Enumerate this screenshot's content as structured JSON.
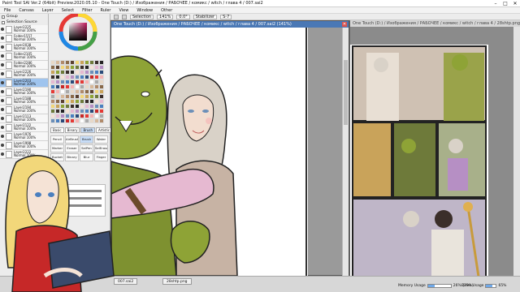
{
  "titlebar": {
    "title": "Paint Tool SAI Ver.2 (64bit) Preview.2020.05.10 - One Touch (D:) / Изображения / РАБОЧЕЕ / комикс / witch / глава 4 / 007.sai2"
  },
  "menu": [
    "File",
    "Canvas",
    "Layer",
    "Select",
    "Filter",
    "Ruler",
    "View",
    "Window",
    "Other"
  ],
  "toolbar": {
    "selection_label": "Selection",
    "zoom": "141%",
    "angle": "0.0°",
    "stabilizer_label": "Stabilizer",
    "stabilizer_value": "S-7"
  },
  "layer_panel": {
    "group_label": "Group",
    "selection_source_label": "Selection Source",
    "layers": [
      {
        "name": "Layer2225",
        "mode": "Normal",
        "opacity": "100%"
      },
      {
        "name": "Folder1557",
        "mode": "Normal",
        "opacity": "100%"
      },
      {
        "name": "Layer2038",
        "mode": "Normal",
        "opacity": "100%"
      },
      {
        "name": "Folder2105",
        "mode": "Normal",
        "opacity": "100%"
      },
      {
        "name": "Folder2286",
        "mode": "Normal",
        "opacity": "100%"
      },
      {
        "name": "Layer2226",
        "mode": "Normal",
        "opacity": "100%"
      },
      {
        "name": "Layer2203",
        "mode": "Normal",
        "opacity": "100%"
      },
      {
        "name": "Layer2190",
        "mode": "Normal",
        "opacity": "100%"
      },
      {
        "name": "Layer2188",
        "mode": "Normal",
        "opacity": "100%"
      },
      {
        "name": "Layer2194",
        "mode": "Normal",
        "opacity": "100%"
      },
      {
        "name": "Layer2113",
        "mode": "Normal",
        "opacity": "100%"
      },
      {
        "name": "Layer2122",
        "mode": "Normal",
        "opacity": "100%"
      },
      {
        "name": "Layer1976",
        "mode": "Normal",
        "opacity": "100%"
      },
      {
        "name": "Layer1998",
        "mode": "Normal",
        "opacity": "100%"
      },
      {
        "name": "Layer2222",
        "mode": "Normal",
        "opacity": "100%"
      }
    ]
  },
  "tools": {
    "tabs": [
      "Basic",
      "Binary",
      "Brush",
      "Artistic"
    ],
    "items": [
      "Pencil",
      "AirBrush",
      "Brush",
      "Water",
      "Marker",
      "Eraser",
      "SelPen",
      "SelErase",
      "Bucket",
      "Binary",
      "Blur",
      "Finger"
    ]
  },
  "canvas_window": {
    "title": "One Touch (D:) / Изображения / РАБОЧЕЕ / комикс / witch / глава 4 / 007.sai2 (141%)"
  },
  "reference_window": {
    "title": "One Touch (D:) / Изображения / РАБОЧЕЕ / комикс / witch / глава 4 / 28shtp.png (25%)"
  },
  "statusbar": {
    "tabs": [
      "007.sai2",
      "28shtp.png"
    ],
    "memory_label": "Memory Usage",
    "memory_value": "26% (29%)",
    "drive_label": "Drive Usage",
    "drive_value": "65%"
  },
  "colors": {
    "accent": "#4a78b5",
    "selected_layer": "#9fc4ee",
    "orc_skin": "#8ea336",
    "elf_hair": "#d9d2c8"
  }
}
